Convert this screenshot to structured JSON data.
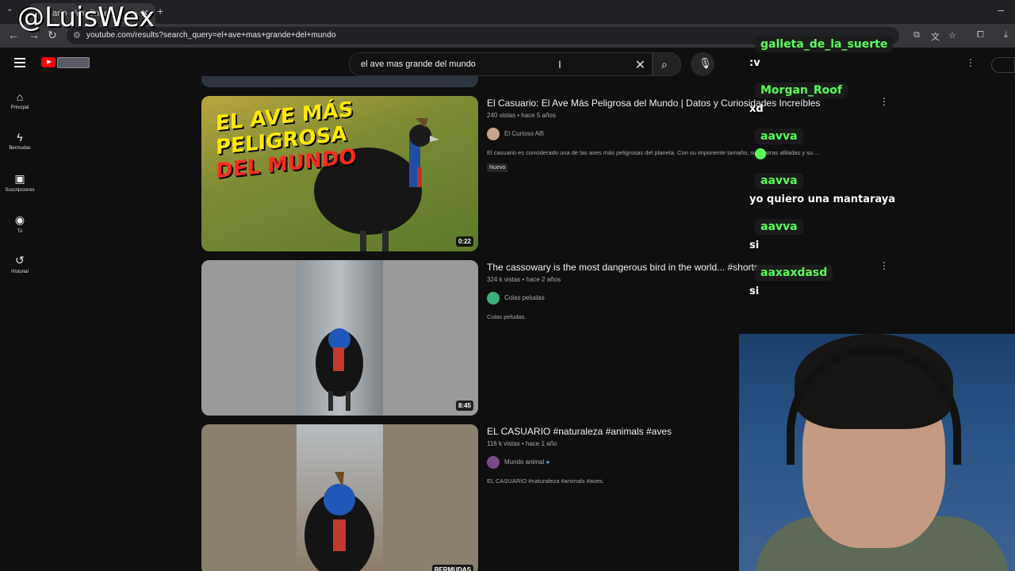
{
  "browser": {
    "tab_title": "ario - YouTube",
    "url": "youtube.com/results?search_query=el+ave+mas+grande+del+mundo"
  },
  "youtube": {
    "search_value": "el ave mas grande del mundo",
    "sidebar": [
      {
        "icon": "home-icon",
        "label": "Principal"
      },
      {
        "icon": "shorts-icon",
        "label": "Bermudas"
      },
      {
        "icon": "subscriptions-icon",
        "label": "Suscripciones"
      },
      {
        "icon": "you-icon",
        "label": "Tú"
      },
      {
        "icon": "history-icon",
        "label": "Historial"
      }
    ],
    "results": [
      {
        "title": "El Casuario: El Ave Más Peligrosa del Mundo | Datos y Curiosidades Increíbles",
        "meta": "240 vistas • hace 5 años",
        "channel": "El Curioso Alfi",
        "description": "El casuario es considerado una de las aves más peligrosas del planeta. Con su imponente tamaño, sus garras afiladas y su ...",
        "badge": "Nuevo",
        "duration": "0:22",
        "thumb_text": [
          "EL AVE MÁS",
          "PELIGROSA",
          "DEL MUNDO"
        ]
      },
      {
        "title": "The cassowary is the most dangerous bird in the world... #shorts",
        "meta": "324 k vistas • hace 2 años",
        "channel": "Colas peludas",
        "description": "Colas peludas.",
        "duration": "8:45"
      },
      {
        "title": "EL CASUARIO #naturaleza #animals #aves",
        "meta": "116 k vistas • hace 1 año",
        "channel": "Mundo animal",
        "description": "EL CASUARIO #naturaleza #animals #aves.",
        "duration": "BERMUDAS"
      }
    ]
  },
  "chat": [
    {
      "user": "galleta_de_la_suerte",
      "message": ":v"
    },
    {
      "user": "Morgan_Roof",
      "message": "xd"
    },
    {
      "user": "aavva",
      "message": ""
    },
    {
      "user": "aavva",
      "message": "yo quiero una mantaraya"
    },
    {
      "user": "aavva",
      "message": "si"
    },
    {
      "user": "aaxaxdasd",
      "message": "si"
    }
  ],
  "watermark": "@LuisWex"
}
